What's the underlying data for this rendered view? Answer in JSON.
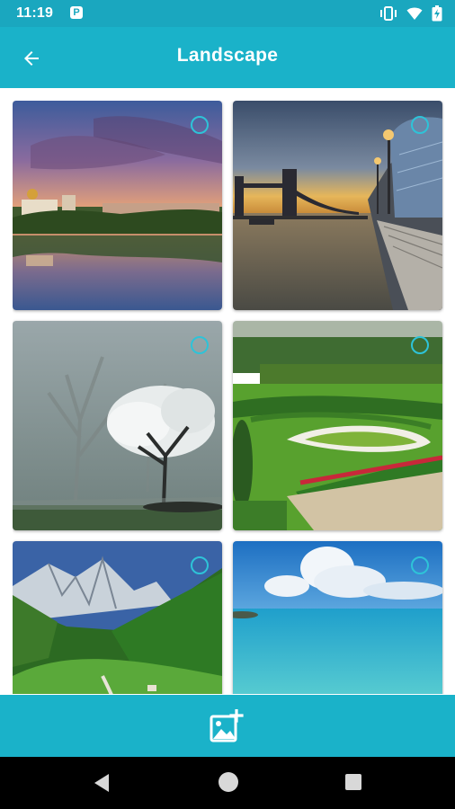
{
  "status_bar": {
    "time": "11:19",
    "notification_letter": "P",
    "icons": [
      "vibrate-icon",
      "wifi-icon",
      "battery-charging-icon"
    ]
  },
  "app_bar": {
    "title": "Landscape",
    "back_icon": "arrow-left-icon"
  },
  "gallery": {
    "images": [
      {
        "name": "monastery-lake-sunset",
        "selected": false
      },
      {
        "name": "tower-bridge-river",
        "selected": false
      },
      {
        "name": "misty-white-tree",
        "selected": false
      },
      {
        "name": "formal-garden-hedges",
        "selected": false
      },
      {
        "name": "mountain-valley-forest",
        "selected": false
      },
      {
        "name": "tropical-beach-sea",
        "selected": false
      }
    ]
  },
  "bottom_bar": {
    "action_icon": "add-photo-icon"
  },
  "nav_bar": {
    "buttons": [
      "nav-back",
      "nav-home",
      "nav-recents"
    ]
  },
  "colors": {
    "primary": "#1ab2c9",
    "status_bar": "#1aa7bf",
    "selection_ring": "#2ec3d8"
  }
}
